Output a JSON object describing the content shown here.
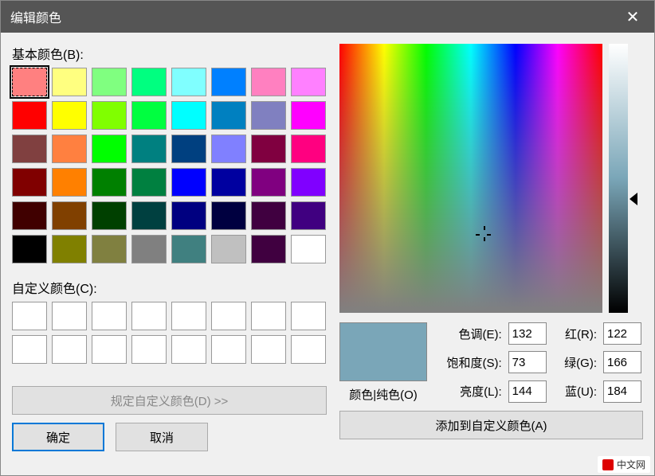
{
  "window": {
    "title": "编辑颜色"
  },
  "labels": {
    "basic_colors": "基本颜色(B):",
    "custom_colors": "自定义颜色(C):",
    "define_custom": "规定自定义颜色(D) >>",
    "ok": "确定",
    "cancel": "取消",
    "color_solid": "颜色|纯色(O)",
    "hue": "色调(E):",
    "sat": "饱和度(S):",
    "lum": "亮度(L):",
    "red": "红(R):",
    "green": "绿(G):",
    "blue": "蓝(U):",
    "add_custom": "添加到自定义颜色(A)"
  },
  "values": {
    "hue": "132",
    "sat": "73",
    "lum": "144",
    "red": "122",
    "green": "166",
    "blue": "184"
  },
  "basic_colors": [
    "#ff8080",
    "#ffff80",
    "#80ff80",
    "#00ff80",
    "#80ffff",
    "#0080ff",
    "#ff80c0",
    "#ff80ff",
    "#ff0000",
    "#ffff00",
    "#80ff00",
    "#00ff40",
    "#00ffff",
    "#0080c0",
    "#8080c0",
    "#ff00ff",
    "#804040",
    "#ff8040",
    "#00ff00",
    "#008080",
    "#004080",
    "#8080ff",
    "#800040",
    "#ff0080",
    "#800000",
    "#ff8000",
    "#008000",
    "#008040",
    "#0000ff",
    "#0000a0",
    "#800080",
    "#8000ff",
    "#400000",
    "#804000",
    "#004000",
    "#004040",
    "#000080",
    "#000040",
    "#400040",
    "#400080",
    "#000000",
    "#808000",
    "#808040",
    "#808080",
    "#408080",
    "#c0c0c0",
    "#400040",
    "#ffffff"
  ],
  "selected_color": "#7aa6b8",
  "watermark": "中文网"
}
